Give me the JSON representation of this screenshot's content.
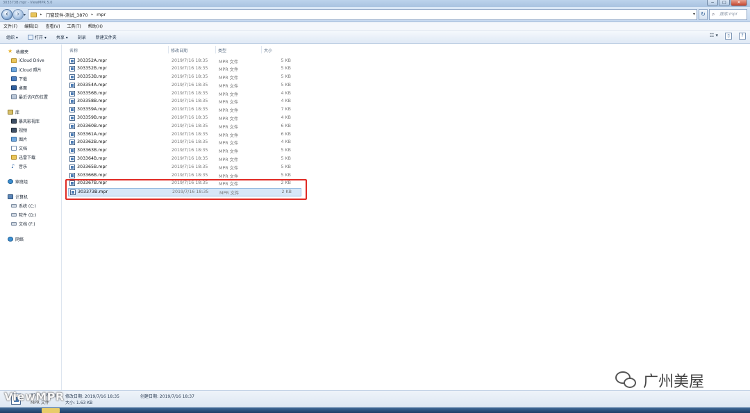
{
  "window": {
    "title": "303373B.mpr - ViewMPR 5.0"
  },
  "controls": {
    "min": "−",
    "max": "□",
    "close": "✕"
  },
  "address": {
    "crumbs": [
      "门窗软件-测试_3870",
      "mpr"
    ],
    "search_placeholder": "搜索 mpr"
  },
  "menu": [
    "文件(F)",
    "编辑(E)",
    "查看(V)",
    "工具(T)",
    "帮助(H)"
  ],
  "toolbar": {
    "organize": "组织 ▾",
    "open": "打开 ▾",
    "share": "共享 ▾",
    "burn": "刻录",
    "new_folder": "新建文件夹"
  },
  "nav": {
    "favorites": {
      "label": "收藏夹",
      "items": [
        "iCloud Drive",
        "iCloud 照片",
        "下载",
        "桌面",
        "最近访问的位置"
      ]
    },
    "libraries": {
      "label": "库",
      "items": [
        "暴风影视库",
        "视频",
        "图片",
        "文档",
        "迅雷下载",
        "音乐"
      ]
    },
    "homegroup": "家庭组",
    "computer": {
      "label": "计算机",
      "items": [
        "系统 (C:)",
        "软件 (D:)",
        "文档 (F:)"
      ]
    },
    "network": "网络"
  },
  "columns": {
    "name": "名称",
    "date": "修改日期",
    "type": "类型",
    "size": "大小"
  },
  "files": [
    {
      "name": "303352A.mpr",
      "date": "2019/7/16 18:35",
      "type": "MPR 文件",
      "size": "5 KB"
    },
    {
      "name": "303352B.mpr",
      "date": "2019/7/16 18:35",
      "type": "MPR 文件",
      "size": "5 KB"
    },
    {
      "name": "303353B.mpr",
      "date": "2019/7/16 18:35",
      "type": "MPR 文件",
      "size": "5 KB"
    },
    {
      "name": "303354A.mpr",
      "date": "2019/7/16 18:35",
      "type": "MPR 文件",
      "size": "5 KB"
    },
    {
      "name": "303356B.mpr",
      "date": "2019/7/16 18:35",
      "type": "MPR 文件",
      "size": "4 KB"
    },
    {
      "name": "303358B.mpr",
      "date": "2019/7/16 18:35",
      "type": "MPR 文件",
      "size": "4 KB"
    },
    {
      "name": "303359A.mpr",
      "date": "2019/7/16 18:35",
      "type": "MPR 文件",
      "size": "7 KB"
    },
    {
      "name": "303359B.mpr",
      "date": "2019/7/16 18:35",
      "type": "MPR 文件",
      "size": "4 KB"
    },
    {
      "name": "303360B.mpr",
      "date": "2019/7/16 18:35",
      "type": "MPR 文件",
      "size": "6 KB"
    },
    {
      "name": "303361A.mpr",
      "date": "2019/7/16 18:35",
      "type": "MPR 文件",
      "size": "6 KB"
    },
    {
      "name": "303362B.mpr",
      "date": "2019/7/16 18:35",
      "type": "MPR 文件",
      "size": "4 KB"
    },
    {
      "name": "303363B.mpr",
      "date": "2019/7/16 18:35",
      "type": "MPR 文件",
      "size": "5 KB"
    },
    {
      "name": "303364B.mpr",
      "date": "2019/7/16 18:35",
      "type": "MPR 文件",
      "size": "5 KB"
    },
    {
      "name": "303365B.mpr",
      "date": "2019/7/16 18:35",
      "type": "MPR 文件",
      "size": "5 KB"
    },
    {
      "name": "303366B.mpr",
      "date": "2019/7/16 18:35",
      "type": "MPR 文件",
      "size": "5 KB"
    },
    {
      "name": "303367B.mpr",
      "date": "2019/7/16 18:35",
      "type": "MPR 文件",
      "size": "2 KB"
    },
    {
      "name": "303373B.mpr",
      "date": "2019/7/16 18:35",
      "type": "MPR 文件",
      "size": "2 KB"
    }
  ],
  "details": {
    "name": "303373B.mpr",
    "type": "MPR 文件",
    "modified": "修改日期: 2019/7/16 18:35",
    "size": "大小: 1.63 KB",
    "created": "创建日期: 2019/7/16 18:37"
  },
  "watermarks": {
    "left": "ViewMPR",
    "right": "广州美屋"
  },
  "colors": {
    "highlight": "#e02a24",
    "selection": "#d7e7f8"
  }
}
